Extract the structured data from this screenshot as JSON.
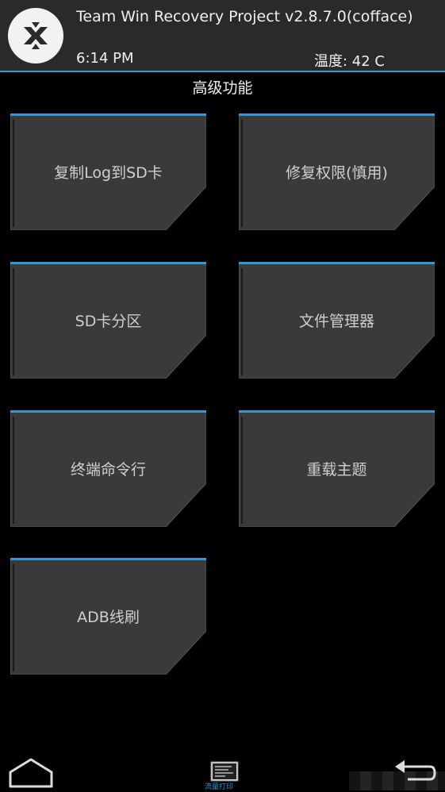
{
  "header": {
    "title": "Team Win Recovery Project  v2.8.7.0(cofface)",
    "time": "6:14 PM",
    "temperature": "温度: 42 C"
  },
  "page": {
    "title": "高级功能"
  },
  "buttons": [
    {
      "label": "复制Log到SD卡"
    },
    {
      "label": "修复权限(慎用)"
    },
    {
      "label": "SD卡分区"
    },
    {
      "label": "文件管理器"
    },
    {
      "label": "终端命令行"
    },
    {
      "label": "重载主题"
    },
    {
      "label": "ADB线刷"
    }
  ],
  "bottom_nav": {
    "log_label": "流量打印"
  },
  "colors": {
    "accent": "#2e9bd6",
    "tile_fill": "#3a3a3a",
    "header_bg": "#2a2a2a"
  },
  "icons": {
    "logo": "twrp-logo-icon",
    "home": "home-icon",
    "log": "console-log-icon",
    "back": "back-arrow-icon"
  }
}
